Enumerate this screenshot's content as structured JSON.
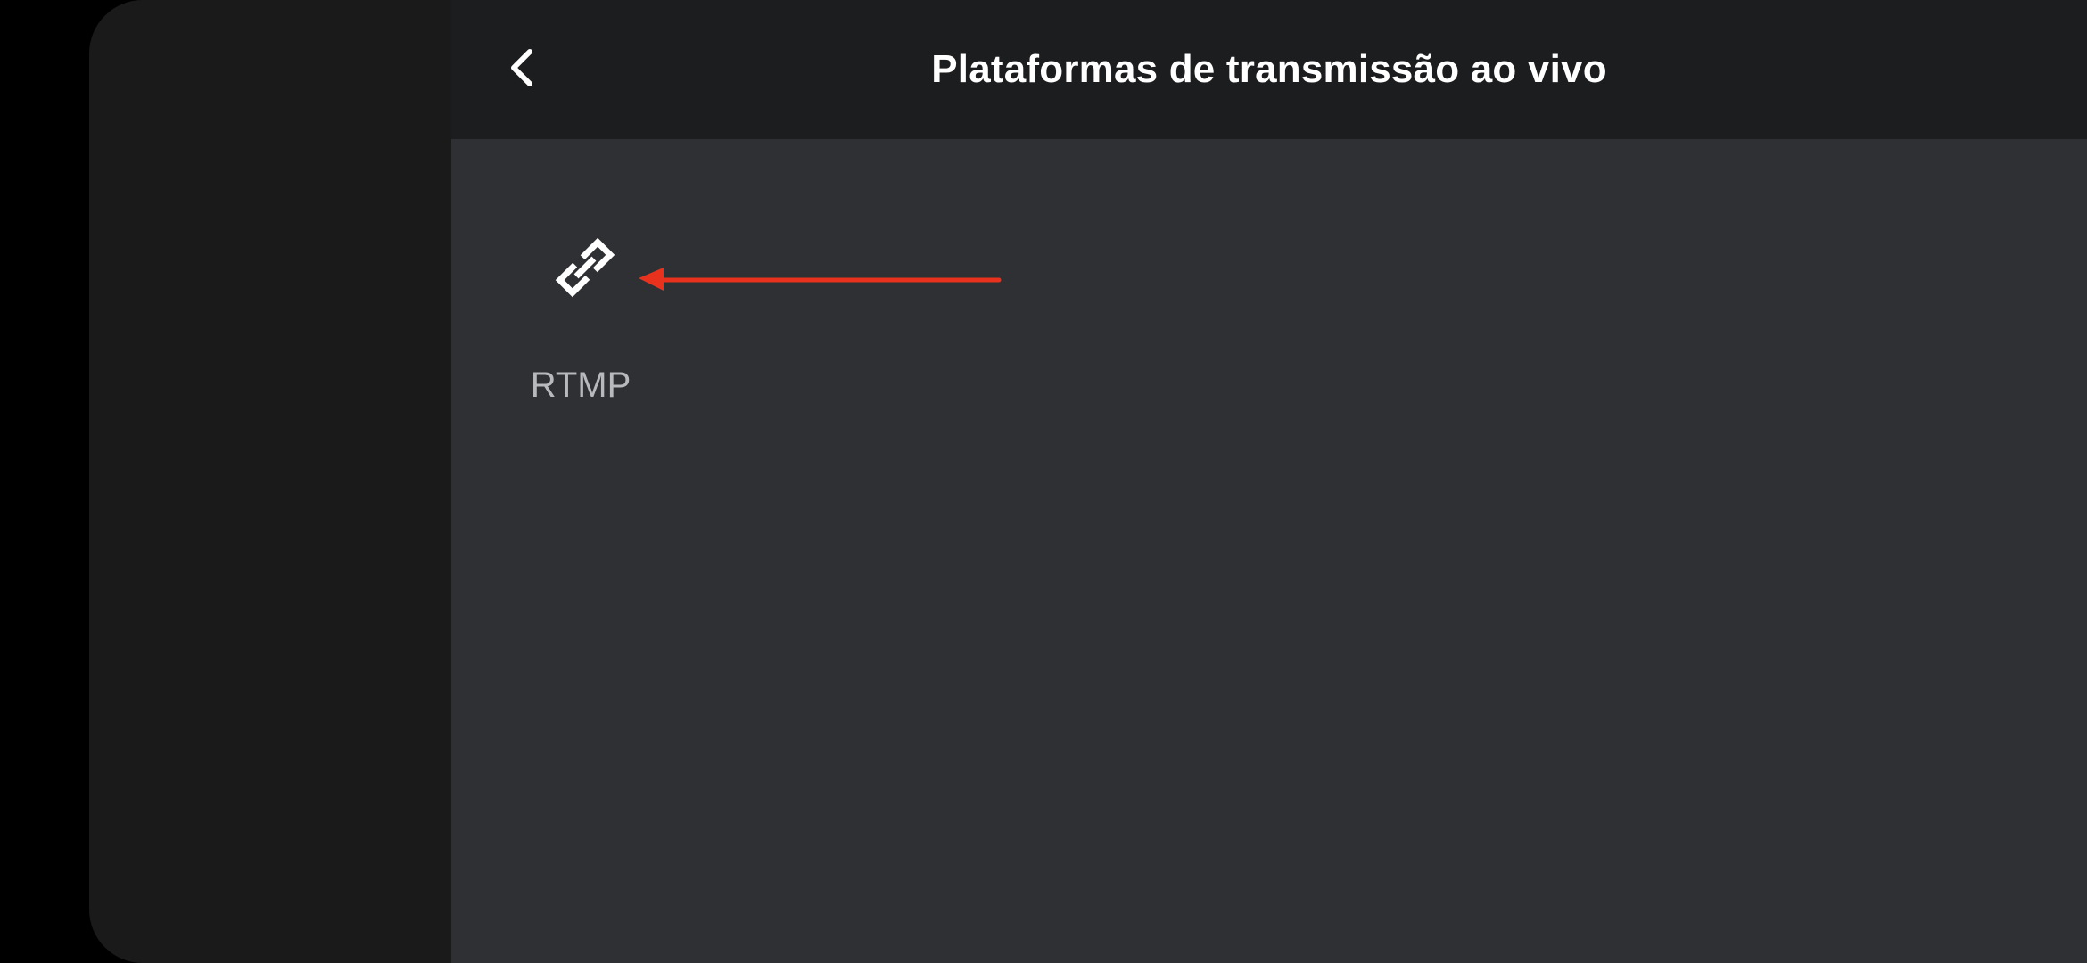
{
  "header": {
    "title": "Plataformas de transmissão ao vivo",
    "back_icon": "chevron-left-icon"
  },
  "platforms": [
    {
      "label": "RTMP",
      "icon": "link-icon"
    }
  ],
  "annotation": {
    "type": "arrow",
    "color": "#e8321e",
    "points_to": "RTMP"
  },
  "colors": {
    "background": "#000000",
    "side_panel": "#1a1a1b",
    "header": "#1c1d1f",
    "content": "#2f3033",
    "title_text": "#ffffff",
    "label_text": "#b8b9bc"
  }
}
